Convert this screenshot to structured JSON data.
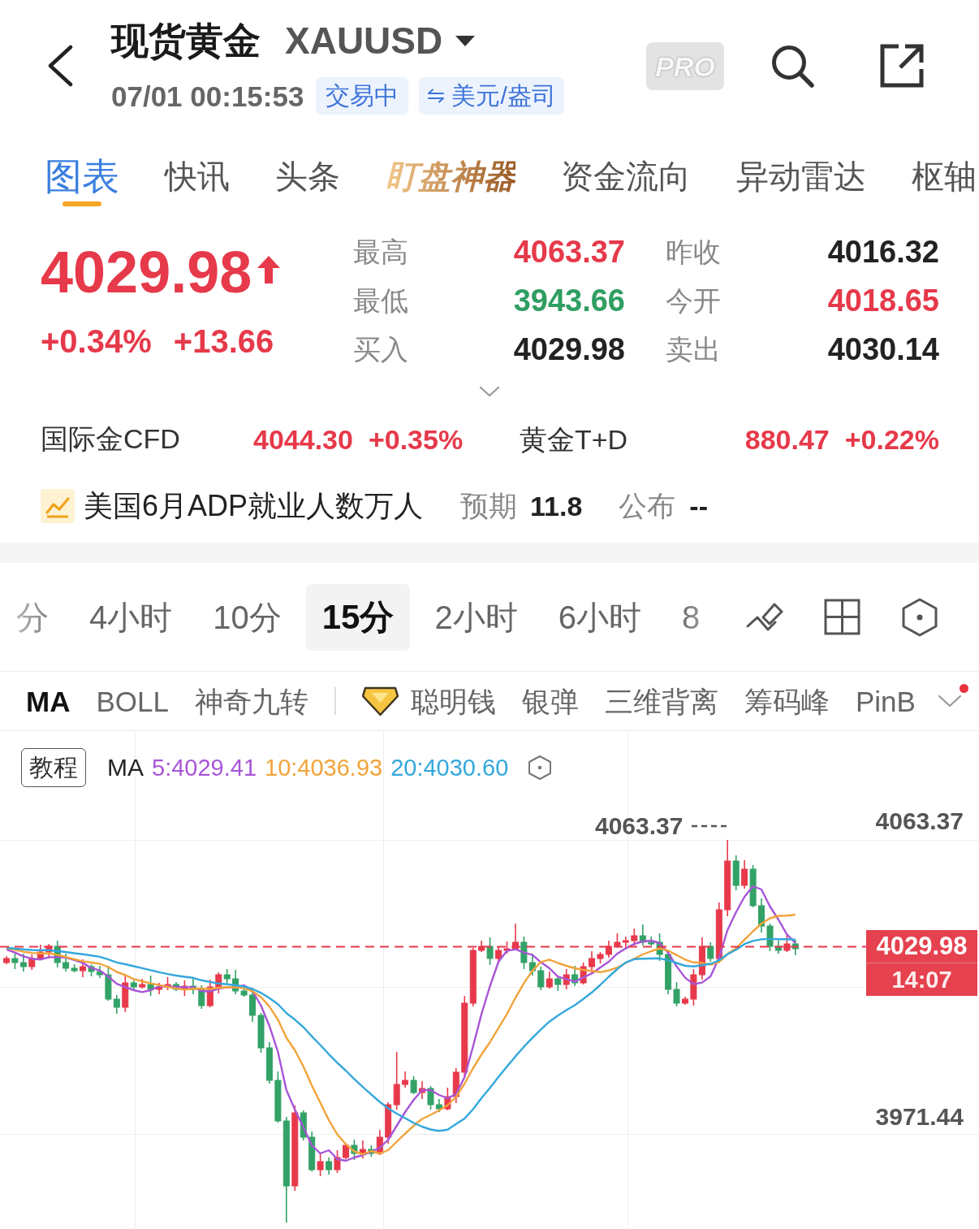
{
  "header": {
    "title": "现货黄金",
    "symbol": "XAUUSD",
    "time": "07/01 00:15:53",
    "market_status": "交易中",
    "unit": "美元/盎司",
    "pro_label": "PRO"
  },
  "tabs": [
    {
      "label": "图表",
      "selected": true,
      "kind": "plain"
    },
    {
      "label": "快讯",
      "selected": false,
      "kind": "plain"
    },
    {
      "label": "头条",
      "selected": false,
      "kind": "plain"
    },
    {
      "label": "盯盘神器",
      "selected": false,
      "kind": "featured"
    },
    {
      "label": "资金流向",
      "selected": false,
      "kind": "plain"
    },
    {
      "label": "异动雷达",
      "selected": false,
      "kind": "plain"
    },
    {
      "label": "枢轴",
      "selected": false,
      "kind": "plain"
    }
  ],
  "quote": {
    "price": "4029.98",
    "rising": true,
    "color": "#e6394a",
    "change_percent": "+0.34%",
    "change": "+13.66"
  },
  "stats": [
    {
      "label": "最高",
      "value": "4063.37",
      "color": "#e6394a"
    },
    {
      "label": "昨收",
      "value": "4016.32",
      "color": "#222222"
    },
    {
      "label": "最低",
      "value": "3943.66",
      "color": "#2f9e63"
    },
    {
      "label": "今开",
      "value": "4018.65",
      "color": "#e6394a"
    },
    {
      "label": "买入",
      "value": "4029.98",
      "color": "#222222"
    },
    {
      "label": "卖出",
      "value": "4030.14",
      "color": "#222222"
    }
  ],
  "related": [
    {
      "name": "国际金CFD",
      "price": "4044.30",
      "change": "+0.35%",
      "color": "#e6394a"
    },
    {
      "name": "黄金T+D",
      "price": "880.47",
      "change": "+0.22%",
      "color": "#e6394a"
    }
  ],
  "event": {
    "title": "美国6月ADP就业人数万人",
    "forecast_label": "预期",
    "forecast": "11.8",
    "actual_label": "公布",
    "actual": "--"
  },
  "periods": [
    {
      "label": "分",
      "selected": false
    },
    {
      "label": "4小时",
      "selected": false
    },
    {
      "label": "10分",
      "selected": false
    },
    {
      "label": "15分",
      "selected": true
    },
    {
      "label": "2小时",
      "selected": false
    },
    {
      "label": "6小时",
      "selected": false
    },
    {
      "label": "8",
      "selected": false
    }
  ],
  "indicators": [
    {
      "label": "MA",
      "selected": true
    },
    {
      "label": "BOLL",
      "selected": false
    },
    {
      "label": "神奇九转",
      "selected": false
    }
  ],
  "special_indicators": [
    {
      "label": "聪明钱",
      "selected": false,
      "vip": true
    },
    {
      "label": "银弹",
      "selected": false,
      "vip": false
    },
    {
      "label": "三维背离",
      "selected": false,
      "vip": false
    },
    {
      "label": "筹码峰",
      "selected": false,
      "vip": false
    },
    {
      "label": "PinB",
      "selected": false,
      "vip": false
    }
  ],
  "indicator_menu": {
    "notification": true
  },
  "chart": {
    "tutorial_button": "教程",
    "ma_label": "MA",
    "ma_values": [
      {
        "text": "5:4029.41",
        "color": "#a855d8"
      },
      {
        "text": "10:4036.93",
        "color": "#f2a33a"
      },
      {
        "text": "20:4030.60",
        "color": "#33a8dc"
      }
    ],
    "high_label": "4063.37",
    "y_axis_labels": [
      "4063.37",
      "3971.44"
    ],
    "price_tag": {
      "price": "4029.98",
      "countdown": "14:07"
    }
  }
}
